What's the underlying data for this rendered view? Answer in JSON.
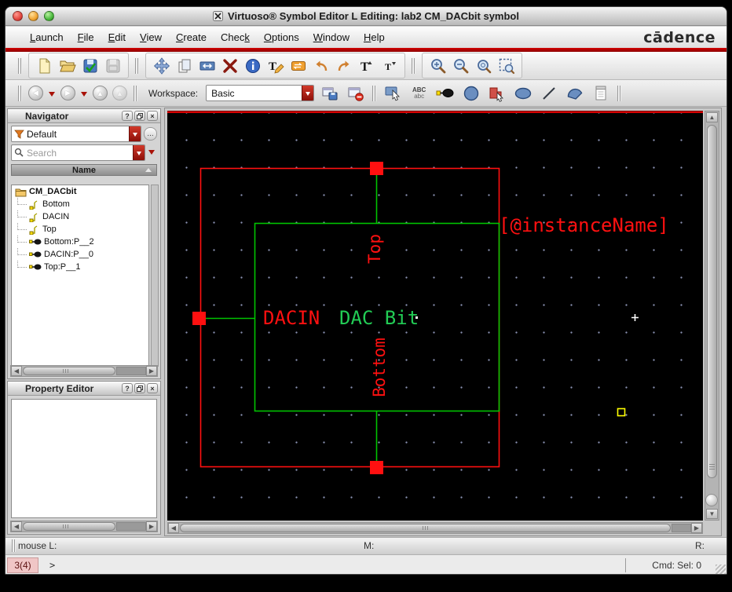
{
  "window": {
    "title": "Virtuoso® Symbol Editor L Editing: lab2 CM_DACbit symbol"
  },
  "brand": {
    "logo": "cādence"
  },
  "menu": {
    "items": [
      {
        "label": "Launch",
        "m": 0
      },
      {
        "label": "File",
        "m": 0
      },
      {
        "label": "Edit",
        "m": 0
      },
      {
        "label": "View",
        "m": 0
      },
      {
        "label": "Create",
        "m": 0
      },
      {
        "label": "Check",
        "m": 4
      },
      {
        "label": "Options",
        "m": 0
      },
      {
        "label": "Window",
        "m": 0
      },
      {
        "label": "Help",
        "m": 0
      }
    ]
  },
  "toolbar": {
    "workspace_label": "Workspace:",
    "workspace_value": "Basic",
    "label_tool_top": "ABC",
    "label_tool_bottom": "abc"
  },
  "navigator": {
    "title": "Navigator",
    "help": "?",
    "close": "×",
    "filter_value": "Default",
    "more": "...",
    "search_placeholder": "Search",
    "header": "Name",
    "items": [
      {
        "label": "CM_DACbit",
        "type": "cell"
      },
      {
        "label": "Bottom",
        "type": "net"
      },
      {
        "label": "DACIN",
        "type": "net"
      },
      {
        "label": "Top",
        "type": "net"
      },
      {
        "label": "Bottom:P__2",
        "type": "pin"
      },
      {
        "label": "DACIN:P__0",
        "type": "pin"
      },
      {
        "label": "Top:P__1",
        "type": "pin"
      }
    ]
  },
  "property_editor": {
    "title": "Property Editor",
    "help": "?",
    "close": "×"
  },
  "canvas": {
    "instance_label": "[@instanceName]",
    "pin_left_label": "DACIN",
    "body_label": "DAC Bit",
    "pin_top_label": "Top",
    "pin_bottom_label": "Bottom",
    "colors": {
      "red": "#ff1010",
      "green": "#00c400",
      "text_green": "#22cc55",
      "grid": "#8890b0",
      "bg": "#000000",
      "highlight": "#ffff00"
    }
  },
  "status": {
    "left": "mouse L:",
    "middle": "M:",
    "right": "R:"
  },
  "cmdline": {
    "hist": "3(4)",
    "prompt": ">",
    "right": "Cmd: Sel: 0"
  }
}
